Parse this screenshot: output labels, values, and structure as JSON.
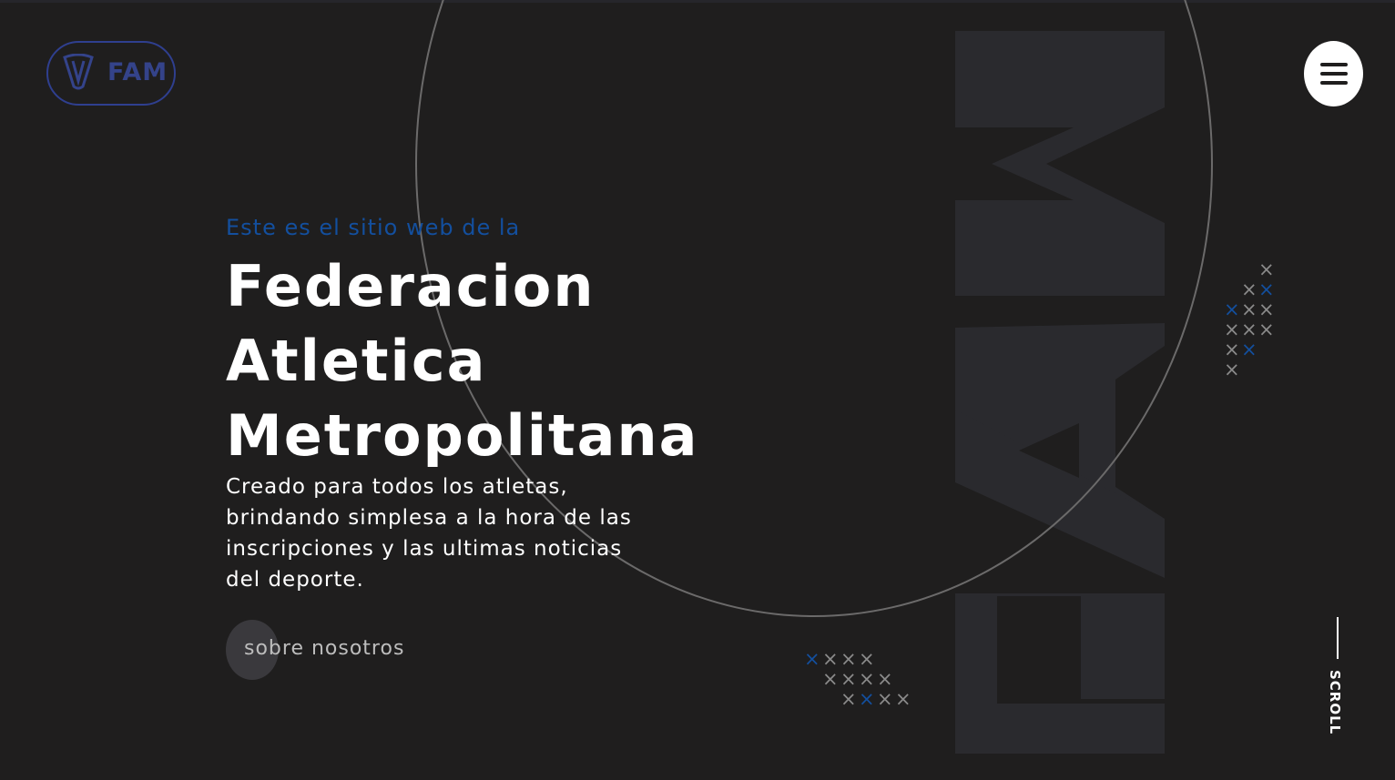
{
  "header": {
    "logo_text": "FAM",
    "menu_icon": "hamburger-menu-icon"
  },
  "hero": {
    "eyebrow": "Este es el sitio web de la",
    "title_lines": [
      "Federacion",
      "Atletica",
      "Metropolitana"
    ],
    "description": "Creado para todos los atletas, brindando simplesa a la hora de las inscripciones y las ultimas noticias del deporte.",
    "cta_label": "sobre nosotros"
  },
  "watermark": {
    "text": "FAM"
  },
  "scroll_indicator": {
    "label": "SCROLL"
  },
  "colors": {
    "background": "#1f1e1e",
    "accent_blue": "#134f9e",
    "logo_blue": "#34438a",
    "watermark": "#2a2a2e",
    "ring": "#6b6a6a",
    "x_gray": "#8a8a8a",
    "text": "#ffffff"
  }
}
